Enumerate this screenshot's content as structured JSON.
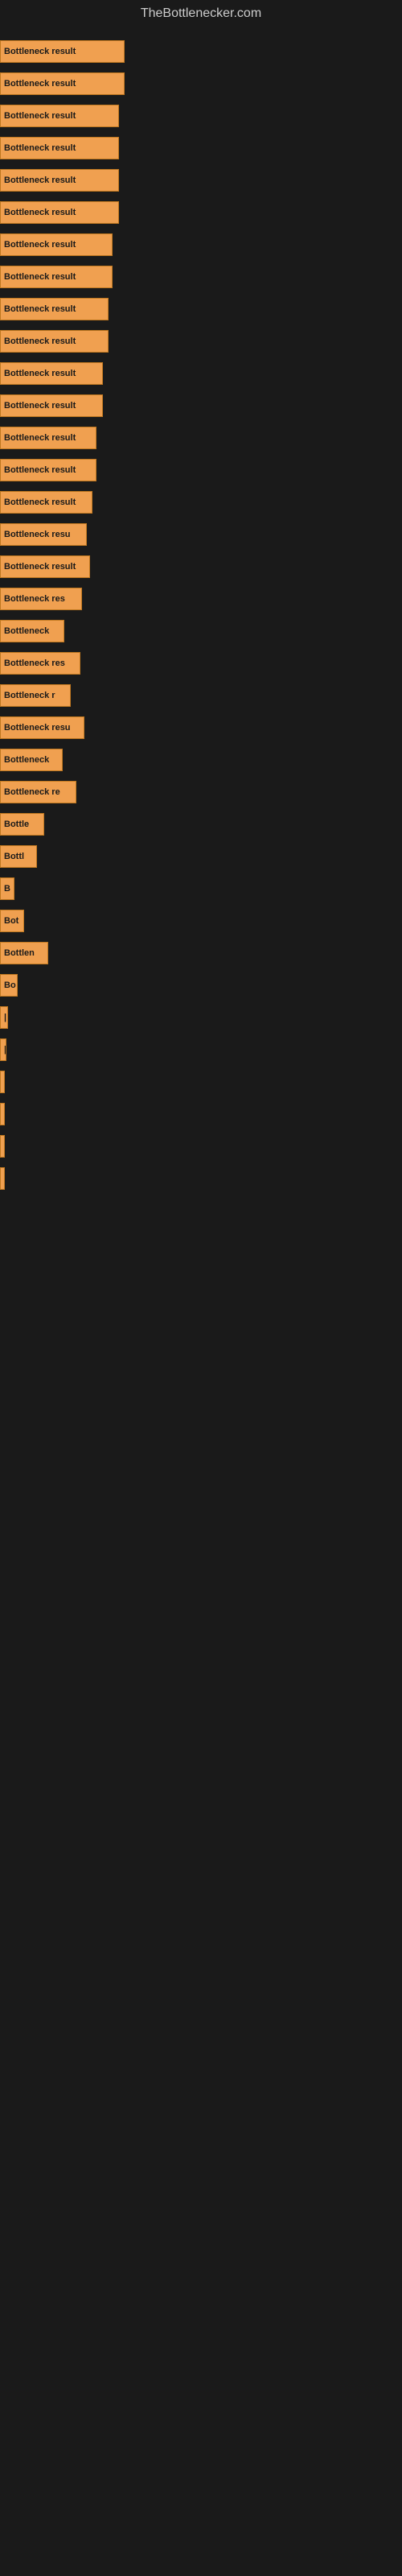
{
  "site": {
    "title": "TheBottlenecker.com"
  },
  "bars": [
    {
      "label": "Bottleneck result",
      "width": 155
    },
    {
      "label": "Bottleneck result",
      "width": 155
    },
    {
      "label": "Bottleneck result",
      "width": 148
    },
    {
      "label": "Bottleneck result",
      "width": 148
    },
    {
      "label": "Bottleneck result",
      "width": 148
    },
    {
      "label": "Bottleneck result",
      "width": 148
    },
    {
      "label": "Bottleneck result",
      "width": 140
    },
    {
      "label": "Bottleneck result",
      "width": 140
    },
    {
      "label": "Bottleneck result",
      "width": 135
    },
    {
      "label": "Bottleneck result",
      "width": 135
    },
    {
      "label": "Bottleneck result",
      "width": 128
    },
    {
      "label": "Bottleneck result",
      "width": 128
    },
    {
      "label": "Bottleneck result",
      "width": 120
    },
    {
      "label": "Bottleneck result",
      "width": 120
    },
    {
      "label": "Bottleneck result",
      "width": 115
    },
    {
      "label": "Bottleneck resu",
      "width": 108
    },
    {
      "label": "Bottleneck result",
      "width": 112
    },
    {
      "label": "Bottleneck res",
      "width": 102
    },
    {
      "label": "Bottleneck",
      "width": 80
    },
    {
      "label": "Bottleneck res",
      "width": 100
    },
    {
      "label": "Bottleneck r",
      "width": 88
    },
    {
      "label": "Bottleneck resu",
      "width": 105
    },
    {
      "label": "Bottleneck",
      "width": 78
    },
    {
      "label": "Bottleneck re",
      "width": 95
    },
    {
      "label": "Bottle",
      "width": 55
    },
    {
      "label": "Bottl",
      "width": 46
    },
    {
      "label": "B",
      "width": 18
    },
    {
      "label": "Bot",
      "width": 30
    },
    {
      "label": "Bottlen",
      "width": 60
    },
    {
      "label": "Bo",
      "width": 22
    },
    {
      "label": "|",
      "width": 10
    },
    {
      "label": "|",
      "width": 8
    },
    {
      "label": "",
      "width": 4
    },
    {
      "label": "",
      "width": 4
    },
    {
      "label": "",
      "width": 3
    },
    {
      "label": "",
      "width": 3
    }
  ]
}
